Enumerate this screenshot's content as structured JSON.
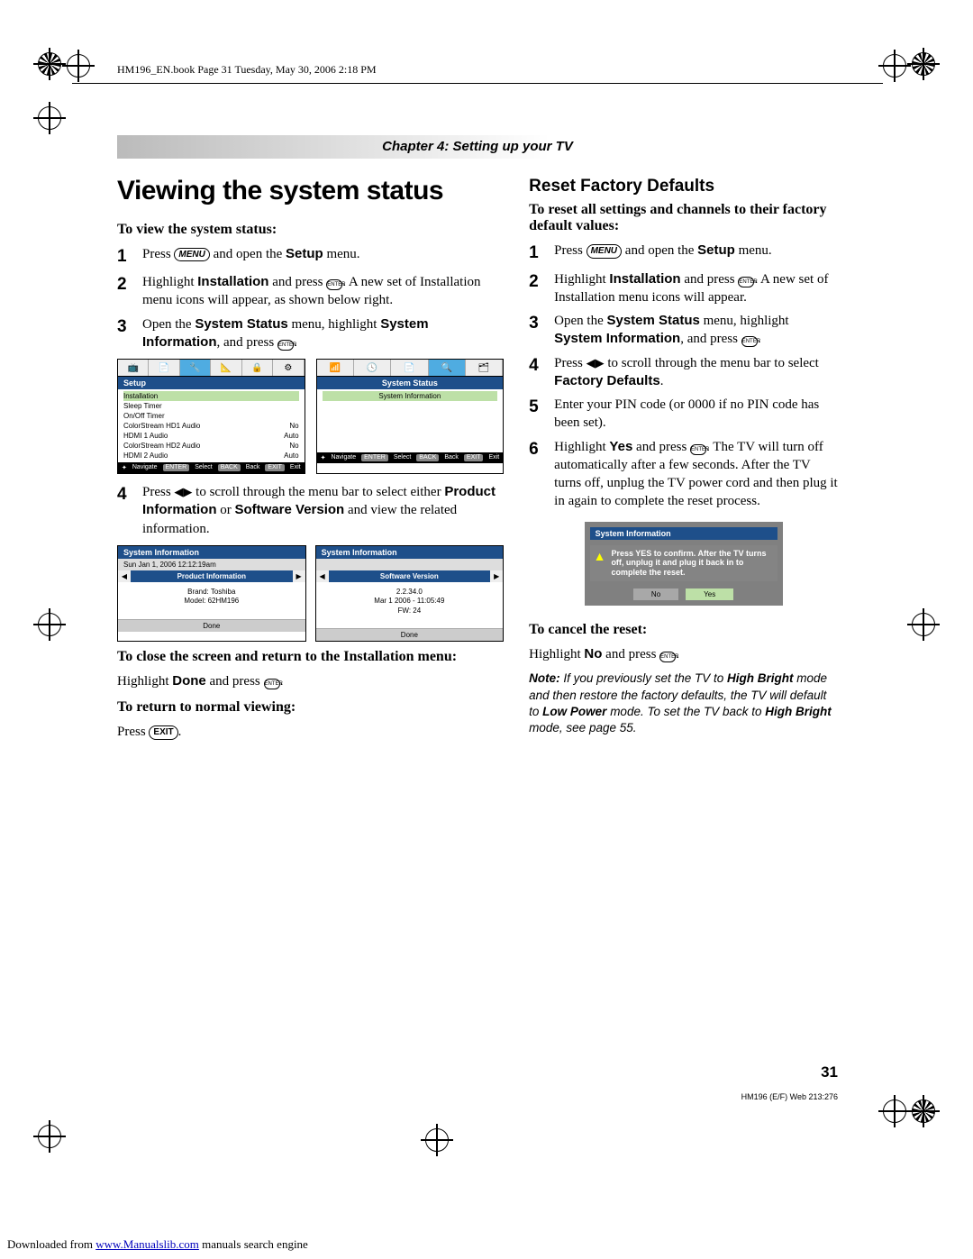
{
  "book_header": "HM196_EN.book  Page 31  Tuesday, May 30, 2006  2:18 PM",
  "chapter": "Chapter 4: Setting up your TV",
  "left": {
    "title": "Viewing the system status",
    "sub1": "To view the system status:",
    "steps_a": [
      {
        "n": "1",
        "pre": "Press ",
        "btn": "MENU",
        "post": " and open the ",
        "bold": "Setup",
        "tail": " menu."
      },
      {
        "n": "2",
        "line": "Highlight <b>Installation</b> and press <span class='enter-icon'>ENTER</span>. A new set of Installation menu icons will appear, as shown below right."
      },
      {
        "n": "3",
        "line": "Open the <b>System Status</b> menu, highlight <b>System Information</b>, and press <span class='enter-icon'>ENTER</span>."
      }
    ],
    "setup_menu": {
      "title": "Setup",
      "rows": [
        [
          "Installation",
          ""
        ],
        [
          "Sleep Timer",
          ""
        ],
        [
          "On/Off Timer",
          ""
        ],
        [
          "ColorStream HD1 Audio",
          "No"
        ],
        [
          "HDMI 1 Audio",
          "Auto"
        ],
        [
          "ColorStream HD2 Audio",
          "No"
        ],
        [
          "HDMI 2 Audio",
          "Auto"
        ]
      ],
      "footer": [
        "Navigate",
        "Select",
        "Back",
        "Exit"
      ]
    },
    "status_menu": {
      "title": "System Status",
      "item": "System Information",
      "footer": [
        "Navigate",
        "Select",
        "Back",
        "Exit"
      ]
    },
    "step4": "Press <span class='arrows'>◀▶</span> to scroll through the menu bar to select either <b>Product Information</b> or <b>Software Version</b> and view the related information.",
    "sysinfo_left": {
      "top": "System Information",
      "date": "Sun Jan 1, 2006  12:12:19am",
      "tab": "Product Information",
      "lines": [
        "Brand:  Toshiba",
        "Model:  62HM196"
      ],
      "done": "Done"
    },
    "sysinfo_right": {
      "top": "System Information",
      "date": "",
      "tab": "Software Version",
      "lines": [
        "2.2.34.0",
        "Mar 1 2006 - 11:05:49",
        "FW: 24"
      ],
      "done": "Done"
    },
    "close_head": "To close the screen and return to the Installation menu:",
    "close_body": "Highlight <b>Done</b> and press <span class='enter-icon'>ENTER</span>.",
    "normal_head": "To return to normal viewing:",
    "normal_body": "Press <span class='btn-icon' style='font-style:normal'>EXIT</span>."
  },
  "right": {
    "heading": "Reset Factory Defaults",
    "sub": "To reset all settings and channels to their factory default values:",
    "steps": [
      {
        "n": "1",
        "line": "Press <span class='btn-icon'>MENU</span> and open the <b>Setup</b> menu."
      },
      {
        "n": "2",
        "line": "Highlight <b>Installation</b> and press <span class='enter-icon'>ENTER</span>. A new set of Installation menu icons will appear."
      },
      {
        "n": "3",
        "line": "Open the <b>System Status</b> menu, highlight <b>System Information</b>, and press <span class='enter-icon'>ENTER</span>."
      },
      {
        "n": "4",
        "line": "Press <span class='arrows'>◀▶</span> to scroll through the menu bar to select <b>Factory Defaults</b>."
      },
      {
        "n": "5",
        "line": "Enter your PIN code (or 0000 if no PIN code has been set)."
      },
      {
        "n": "6",
        "line": "Highlight <b>Yes</b> and press <span class='enter-icon'>ENTER</span>. The TV will turn off automatically after a few seconds. After the TV turns off, unplug the TV power cord and then plug it in again to complete the reset process."
      }
    ],
    "modal": {
      "title": "System Information",
      "msg": "Press YES to confirm. After the TV turns off, unplug it and plug it back in to complete the reset.",
      "no": "No",
      "yes": "Yes"
    },
    "cancel_head": "To cancel the reset:",
    "cancel_body": "Highlight <b>No</b> and press <span class='enter-icon'>ENTER</span>.",
    "note": "<b>Note:</b> If you previously set the TV to <b>High Bright</b> mode and then restore the factory defaults, the TV will default to <b>Low Power</b> mode. To set the TV back to <b>High Bright</b> mode, see page 55."
  },
  "page_number": "31",
  "page_foot_right": "HM196 (E/F) Web 213:276",
  "download": "Downloaded from ",
  "download_link": "www.Manualslib.com",
  "download_tail": " manuals search engine"
}
